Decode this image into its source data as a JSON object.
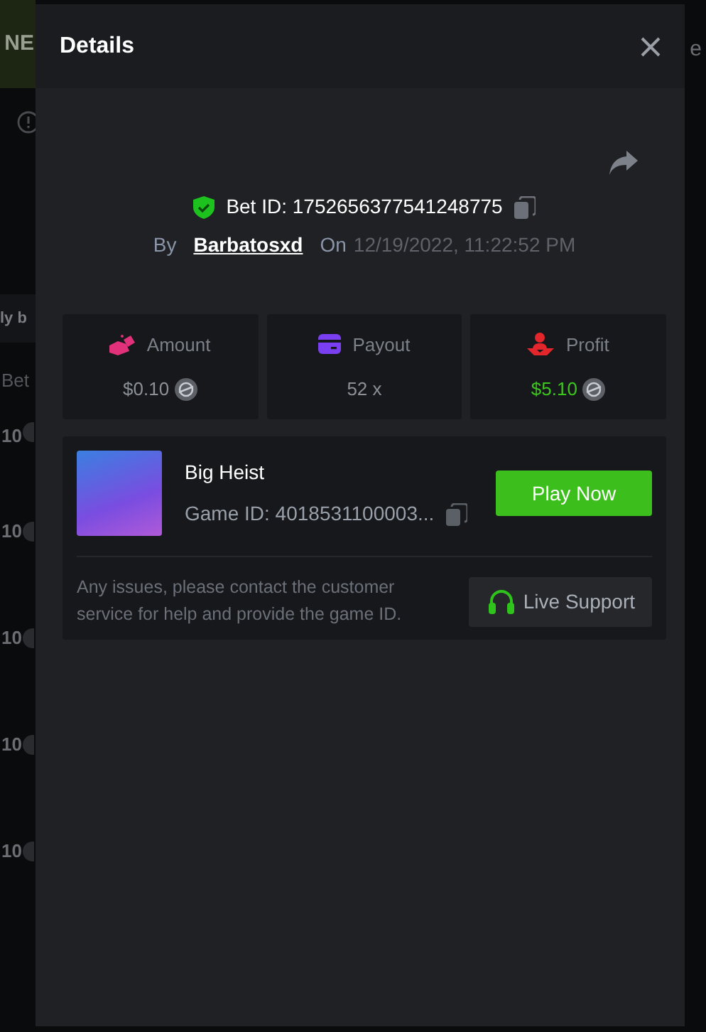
{
  "background": {
    "logo_text": "NE",
    "edge_text": "e",
    "section_title": "ly b",
    "column_header": "Bet",
    "amounts": [
      "10",
      "10",
      "10",
      "10",
      "10"
    ]
  },
  "modal": {
    "title": "Details",
    "verified": true,
    "bet_id": "Bet ID: 1752656377541248775",
    "by_label": "By",
    "user": "Barbatosxd",
    "on_label": "On",
    "date": "12/19/2022, 11:22:52 PM",
    "stats": [
      {
        "kind": "amount",
        "label": "Amount",
        "value": "$0.10",
        "coin": true,
        "positive": false,
        "color": "#e0317a"
      },
      {
        "kind": "payout",
        "label": "Payout",
        "value": "52 x",
        "coin": false,
        "positive": false,
        "color": "#7b3ff2"
      },
      {
        "kind": "profit",
        "label": "Profit",
        "value": "$5.10",
        "coin": true,
        "positive": true,
        "color": "#e3262b"
      }
    ],
    "game": {
      "name": "Big Heist",
      "game_id": "Game ID: 4018531100003...",
      "play_button": "Play Now"
    },
    "support": {
      "note": "Any issues, please contact the customer service for help and provide the game ID.",
      "button": "Live Support"
    }
  }
}
